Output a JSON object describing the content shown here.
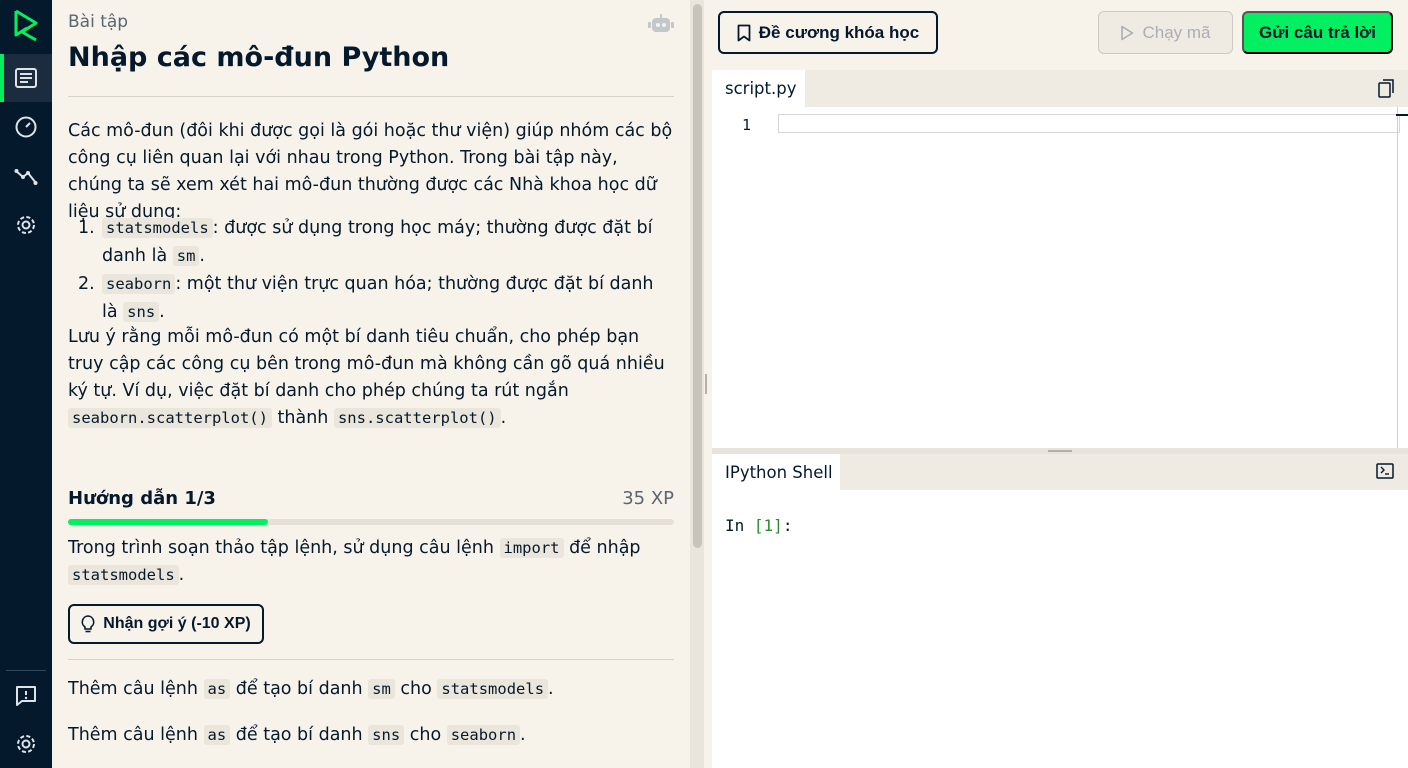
{
  "exercise": {
    "eyebrow": "Bài tập",
    "title": "Nhập các mô-đun Python",
    "intro": "Các mô-đun (đôi khi được gọi là gói hoặc thư viện) giúp nhóm các bộ công cụ liên quan lại với nhau trong Python. Trong bài tập này, chúng ta sẽ xem xét hai mô-đun thường được các Nhà khoa học dữ liệu sử dụng:",
    "modules": [
      {
        "num": "1.",
        "code": "statsmodels",
        "text": ": được sử dụng trong học máy; thường được đặt bí danh là ",
        "alias": "sm",
        "end": "."
      },
      {
        "num": "2.",
        "code": "seaborn",
        "text": ": một thư viện trực quan hóa; thường được đặt bí danh là ",
        "alias": "sns",
        "end": "."
      }
    ],
    "note": {
      "text": "Lưu ý rằng mỗi mô-đun có một bí danh tiêu chuẩn, cho phép bạn truy cập các công cụ bên trong mô-đun mà không cần gõ quá nhiều ký tự. Ví dụ, việc đặt bí danh cho phép chúng ta rút ngắn ",
      "code1": "seaborn.scatterplot()",
      "mid": " thành ",
      "code2": "sns.scatterplot()",
      "end": "."
    },
    "instructions": {
      "heading": "Hướng dẫn 1/3",
      "xp": "35 XP",
      "progress": 0.33,
      "step_pre": "Trong trình soạn thảo tập lệnh, sử dụng câu lệnh ",
      "step_code": "import",
      "step_mid": " để nhập ",
      "step_code2": "statsmodels",
      "step_end": "."
    },
    "hint_button": "Nhận gợi ý (-10 XP)",
    "todo": [
      {
        "pre": "Thêm câu lệnh ",
        "code": "as",
        "mid": " để tạo bí danh ",
        "alias": "sm",
        "mid2": " cho ",
        "target": "statsmodels",
        "end": "."
      },
      {
        "pre": "Thêm câu lệnh ",
        "code": "as",
        "mid": " để tạo bí danh ",
        "alias": "sns",
        "mid2": " cho ",
        "target": "seaborn",
        "end": "."
      }
    ]
  },
  "toolbar": {
    "course_outline": "Đề cương khóa học",
    "run": "Chạy mã",
    "submit": "Gửi câu trả lời"
  },
  "editor": {
    "tab": "script.py",
    "line_number": "1"
  },
  "shell": {
    "tab": "IPython Shell",
    "prompt_in": "In ",
    "prompt_num": "[1]",
    "prompt_colon": ":"
  },
  "colors": {
    "accent": "#03ef62",
    "navy": "#05192d",
    "background": "#f7f3eb"
  },
  "icons": [
    "datacamp-logo-icon",
    "exercise-icon",
    "dashboard-icon",
    "graph-icon",
    "settings-icon",
    "feedback-icon",
    "robot-icon",
    "bookmark-icon",
    "play-icon",
    "copy-icon",
    "lightbulb-icon",
    "expand-icon"
  ]
}
